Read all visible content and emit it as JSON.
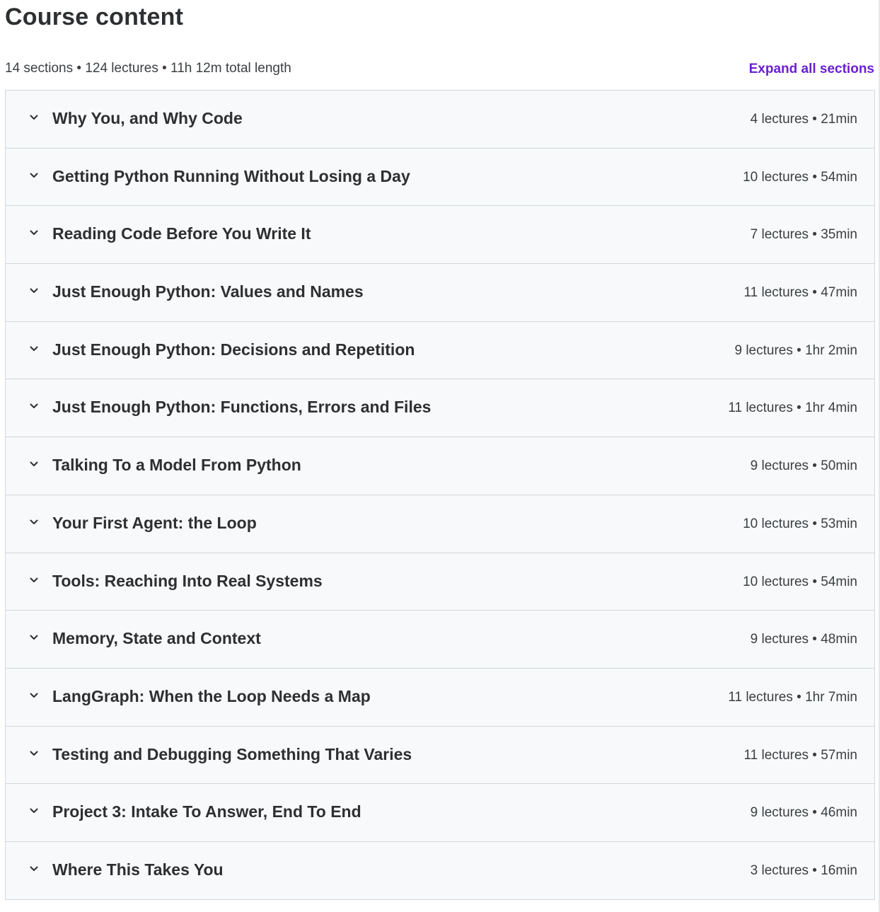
{
  "header": {
    "title": "Course content",
    "summary": "14 sections • 124 lectures • 11h 12m total length",
    "expand_all_label": "Expand all sections"
  },
  "sections": [
    {
      "title": "Why You, and Why Code",
      "meta": "4 lectures • 21min"
    },
    {
      "title": "Getting Python Running Without Losing a Day",
      "meta": "10 lectures • 54min"
    },
    {
      "title": "Reading Code Before You Write It",
      "meta": "7 lectures • 35min"
    },
    {
      "title": "Just Enough Python: Values and Names",
      "meta": "11 lectures • 47min"
    },
    {
      "title": "Just Enough Python: Decisions and Repetition",
      "meta": "9 lectures • 1hr 2min"
    },
    {
      "title": "Just Enough Python: Functions, Errors and Files",
      "meta": "11 lectures • 1hr 4min"
    },
    {
      "title": "Talking To a Model From Python",
      "meta": "9 lectures • 50min"
    },
    {
      "title": "Your First Agent: the Loop",
      "meta": "10 lectures • 53min"
    },
    {
      "title": "Tools: Reaching Into Real Systems",
      "meta": "10 lectures • 54min"
    },
    {
      "title": "Memory, State and Context",
      "meta": "9 lectures • 48min"
    },
    {
      "title": "LangGraph: When the Loop Needs a Map",
      "meta": "11 lectures • 1hr 7min"
    },
    {
      "title": "Testing and Debugging Something That Varies",
      "meta": "11 lectures • 57min"
    },
    {
      "title": "Project 3: Intake To Answer, End To End",
      "meta": "9 lectures • 46min"
    },
    {
      "title": "Where This Takes You",
      "meta": "3 lectures • 16min"
    }
  ],
  "icons": {
    "section_toggle": "chevron-down-icon"
  },
  "colors": {
    "accent": "#6a1fd1",
    "row_background": "#f7f9fa",
    "border": "#d1d7dc",
    "text": "#2d2f31"
  }
}
